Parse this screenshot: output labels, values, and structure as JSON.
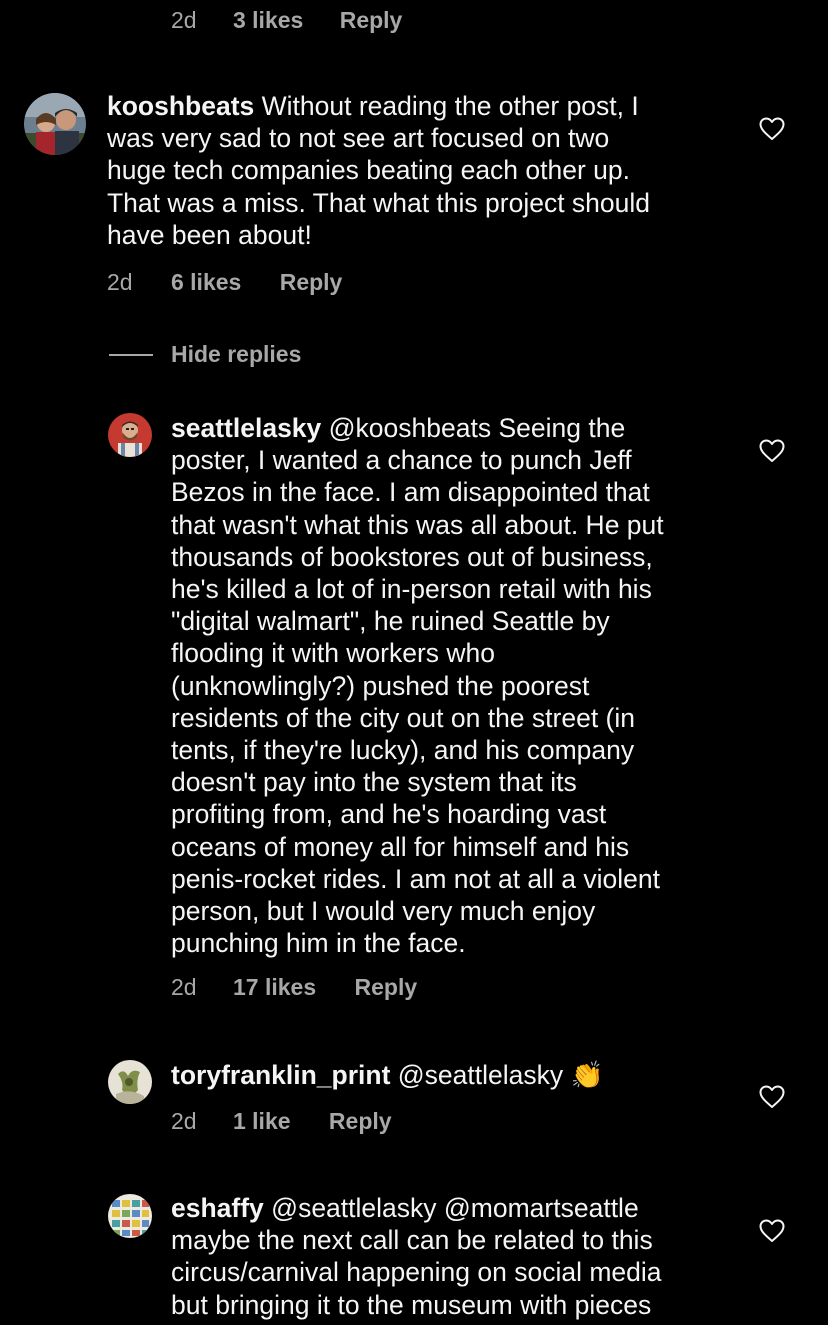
{
  "top_meta": {
    "time": "2d",
    "likes": "3 likes",
    "reply": "Reply"
  },
  "comment1": {
    "username": "kooshbeats",
    "lines": [
      "Without reading the other post, I",
      "was very sad to not see art focused on two",
      "huge tech companies beating each other up.",
      "That was a miss. That what this project should",
      "have been about!"
    ],
    "time": "2d",
    "likes": "6 likes",
    "reply": "Reply"
  },
  "hide_replies": "Hide replies",
  "reply1": {
    "username": "seattlelasky",
    "lines": [
      "@kooshbeats Seeing the",
      "poster, I wanted a chance to punch Jeff",
      "Bezos in the face. I am disappointed that",
      "that wasn't what this was all about. He put",
      "thousands of bookstores out of business,",
      "he's killed a lot of in-person retail with his",
      "\"digital walmart\", he ruined Seattle by",
      "flooding it with workers who",
      "(unknowlingly?) pushed the poorest",
      "residents of the city out on the street (in",
      "tents, if they're lucky), and his company",
      "doesn't pay into the system that its",
      "profiting from, and he's hoarding vast",
      "oceans of money all for himself and his",
      "penis-rocket rides. I am not at all a violent",
      "person, but I would very much enjoy",
      "punching him in the face."
    ],
    "time": "2d",
    "likes": "17 likes",
    "reply": "Reply"
  },
  "reply2": {
    "username": "toryfranklin_print",
    "lines": [
      "@seattlelasky 👏"
    ],
    "time": "2d",
    "likes": "1 like",
    "reply": "Reply"
  },
  "reply3": {
    "username": "eshaffy",
    "lines": [
      "@seattlelasky @momartseattle",
      "maybe the next call can be related to this",
      "circus/carnival happening on social media",
      "but bringing it to the museum with pieces"
    ]
  },
  "colors": {
    "background": "#000000",
    "text": "#f5f5f5",
    "secondary": "#a8a8a8"
  },
  "icons": {
    "like": "heart-outline-icon"
  }
}
